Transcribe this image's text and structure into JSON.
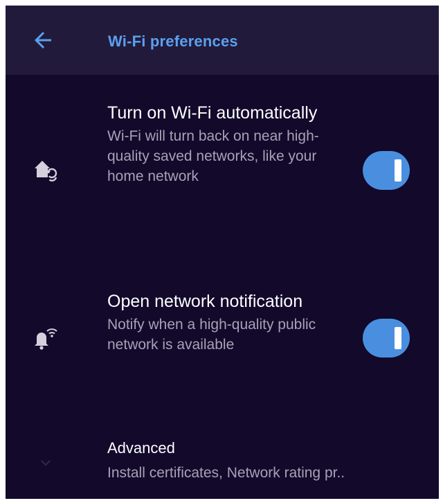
{
  "header": {
    "title": "Wi-Fi preferences",
    "back_icon": "arrow-back-icon"
  },
  "settings": [
    {
      "title": "Turn on Wi-Fi automatically",
      "summary": "Wi-Fi will turn back on near high-quality saved networks, like your home network",
      "icon": "home-sync-icon",
      "enabled": true
    },
    {
      "title": "Open network notification",
      "summary": "Notify when a high-quality public network is available",
      "icon": "wifi-bell-icon",
      "enabled": true
    }
  ],
  "advanced": {
    "title": "Advanced",
    "summary": "Install certificates, Network rating pr..",
    "icon": "chevron-down-icon"
  },
  "colors": {
    "background": "#12092b",
    "appbar": "#221a3a",
    "accent": "#5aa0f0",
    "toggle_on": "#4a8fdf",
    "secondary_text": "#a7a2b6"
  }
}
